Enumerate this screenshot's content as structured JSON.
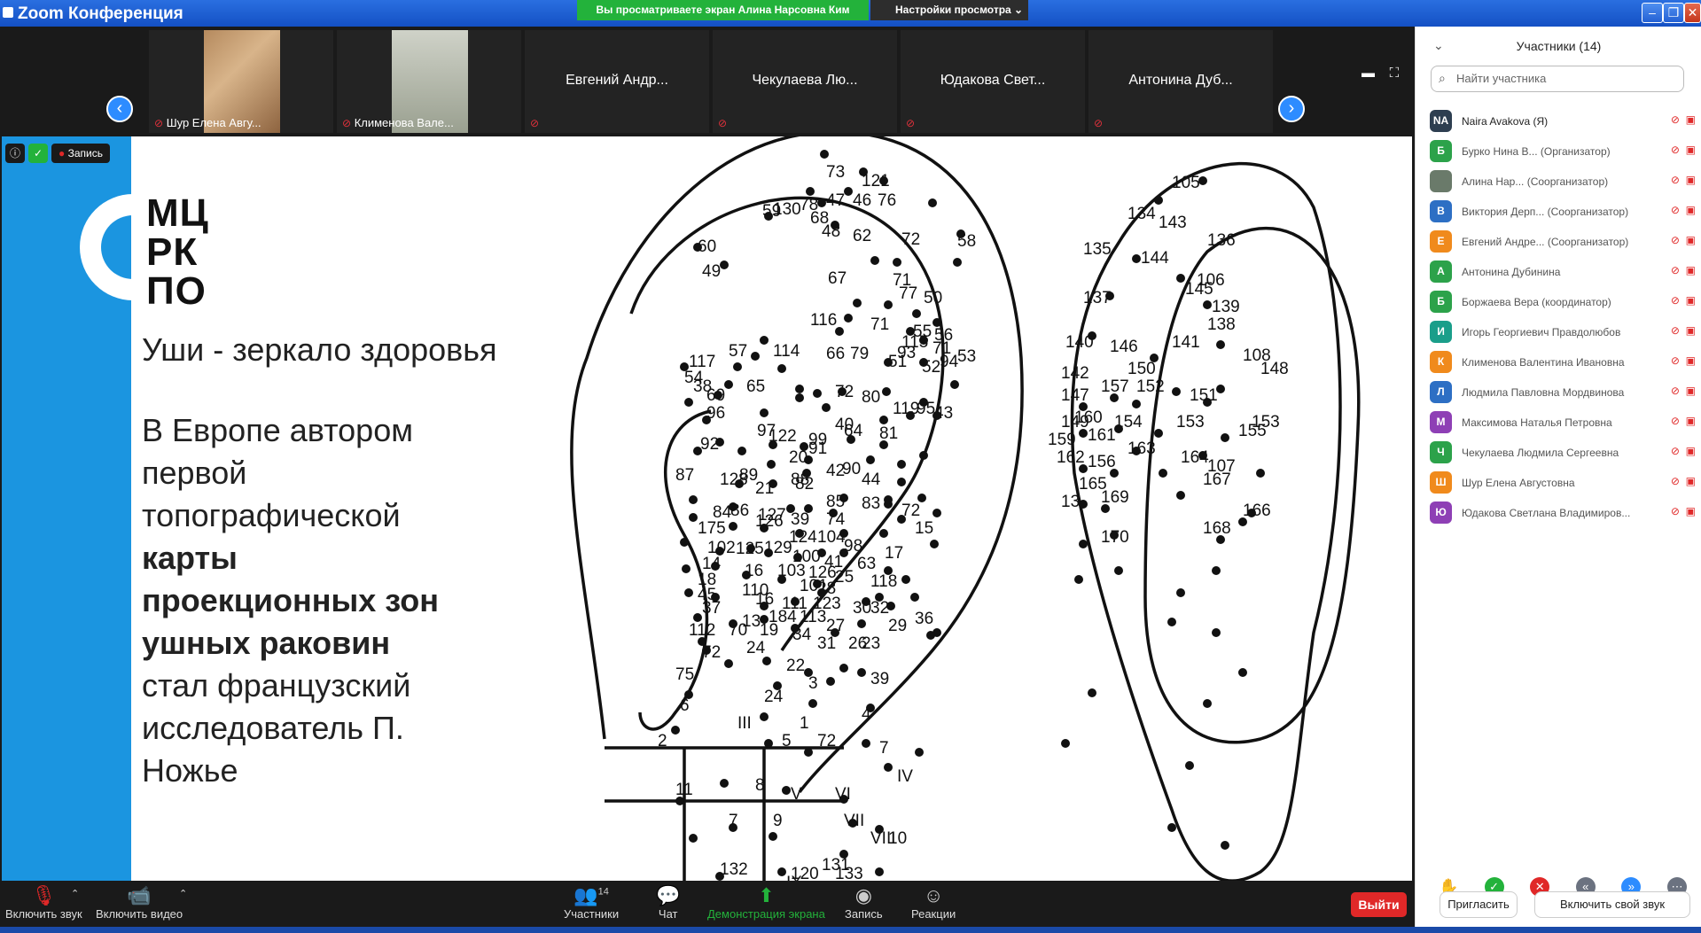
{
  "window": {
    "title": "Zoom Конференция",
    "viewing_banner": "Вы просматриваете экран Алина Нарсовна Ким",
    "view_options_label": "Настройки просмотра",
    "min_icon": "minimize-icon",
    "restore_icon": "restore-icon",
    "close_icon": "close-icon"
  },
  "thumbnails": [
    {
      "label": "Шур Елена Авгу...",
      "type": "video"
    },
    {
      "label": "Клименова Вале...",
      "type": "video"
    },
    {
      "label": "Евгений Андр...",
      "type": "name"
    },
    {
      "label": "Чекулаева Лю...",
      "type": "name"
    },
    {
      "label": "Юдакова Свет...",
      "type": "name"
    },
    {
      "label": "Антонина Дуб...",
      "type": "name"
    }
  ],
  "share": {
    "record_badge": "Запись",
    "logo_lines": [
      "МЦ",
      "РК",
      "ПО"
    ],
    "heading": "Уши - зеркало здоровья",
    "body_lead": "В Европе автором первой топографической",
    "body_bold": "карты проекционных зон ушных раковин",
    "body_tail": "стал французский исследователь П. Ножье",
    "diagram_labels": [
      "73",
      "121",
      "78",
      "47",
      "46",
      "76",
      "130",
      "59",
      "68",
      "48",
      "62",
      "72",
      "58",
      "60",
      "49",
      "67",
      "71",
      "77",
      "50",
      "116",
      "71",
      "55",
      "56",
      "115",
      "71",
      "57",
      "117",
      "114",
      "66",
      "79",
      "51",
      "93",
      "52",
      "94",
      "53",
      "54",
      "38",
      "69",
      "65",
      "72",
      "80",
      "119",
      "95",
      "43",
      "96",
      "97",
      "40",
      "81",
      "92",
      "122",
      "99",
      "64",
      "20",
      "91",
      "90",
      "89",
      "42",
      "88",
      "44",
      "87",
      "128",
      "21",
      "82",
      "85",
      "83",
      "84",
      "86",
      "127",
      "39",
      "74",
      "72",
      "15",
      "175",
      "126",
      "124",
      "104",
      "98",
      "17",
      "102",
      "125",
      "129",
      "100",
      "41",
      "63",
      "14",
      "16",
      "103",
      "126",
      "25",
      "118",
      "18",
      "110",
      "101",
      "28",
      "45",
      "16",
      "111",
      "123",
      "30",
      "37",
      "13",
      "184",
      "113",
      "27",
      "32",
      "29",
      "112",
      "70",
      "19",
      "34",
      "31",
      "26",
      "36",
      "72",
      "24",
      "22",
      "23",
      "39",
      "75",
      "24",
      "3",
      "6",
      "III",
      "1",
      "4",
      "2",
      "5",
      "72",
      "7",
      "IV",
      "8",
      "V",
      "VI",
      "11",
      "7",
      "9",
      "VII",
      "VIII",
      "IX",
      "10",
      "131",
      "132",
      "120",
      "133",
      "105",
      "134",
      "143",
      "136",
      "135",
      "144",
      "106",
      "137",
      "145",
      "139",
      "140",
      "138",
      "146",
      "141",
      "108",
      "142",
      "150",
      "148",
      "147",
      "157",
      "152",
      "151",
      "149",
      "160",
      "154",
      "153",
      "153",
      "159",
      "161",
      "163",
      "155",
      "162",
      "156",
      "164",
      "107",
      "165",
      "167",
      "166",
      "13",
      "169",
      "168",
      "170"
    ]
  },
  "toolbar": {
    "unmute": "Включить звук",
    "start_video": "Включить видео",
    "participants": "Участники",
    "participants_count": "14",
    "chat": "Чат",
    "share_screen": "Демонстрация экрана",
    "record": "Запись",
    "reactions": "Реакции",
    "leave": "Выйти",
    "share_color": "#23b23b",
    "leave_color": "#e02828"
  },
  "panel": {
    "title": "Участники (14)",
    "search_placeholder": "Найти участника",
    "participants": [
      {
        "initials": "NA",
        "name": "Naira Avakova (Я)",
        "color": "#2d3e50"
      },
      {
        "initials": "Б",
        "name": "Бурко Нина В... (Организатор)",
        "color": "#2ca24a"
      },
      {
        "initials": "",
        "name": "Алина Нар... (Соорганизатор)",
        "color": "#6a7a6a"
      },
      {
        "initials": "В",
        "name": "Виктория Дерп... (Соорганизатор)",
        "color": "#2d6fc4"
      },
      {
        "initials": "Е",
        "name": "Евгений Андре... (Соорганизатор)",
        "color": "#f08a1c"
      },
      {
        "initials": "А",
        "name": "Антонина Дубинина",
        "color": "#2ca24a"
      },
      {
        "initials": "Б",
        "name": "Боржаева Вера (координатор)",
        "color": "#2ca24a"
      },
      {
        "initials": "И",
        "name": "Игорь Георгиевич Правдолюбов",
        "color": "#1a9e8a"
      },
      {
        "initials": "К",
        "name": "Клименова Валентина Ивановна",
        "color": "#f08a1c"
      },
      {
        "initials": "Л",
        "name": "Людмила Павловна Мордвинова",
        "color": "#2d6fc4"
      },
      {
        "initials": "М",
        "name": "Максимова Наталья Петровна",
        "color": "#8e3fb5"
      },
      {
        "initials": "Ч",
        "name": "Чекулаева Людмила Сергеевна",
        "color": "#2ca24a"
      },
      {
        "initials": "Ш",
        "name": "Шур Елена Августовна",
        "color": "#f08a1c"
      },
      {
        "initials": "Ю",
        "name": "Юдакова Светлана Владимиров...",
        "color": "#8e3fb5"
      }
    ],
    "invite": "Пригласить",
    "unmute_me": "Включить свой звук"
  }
}
